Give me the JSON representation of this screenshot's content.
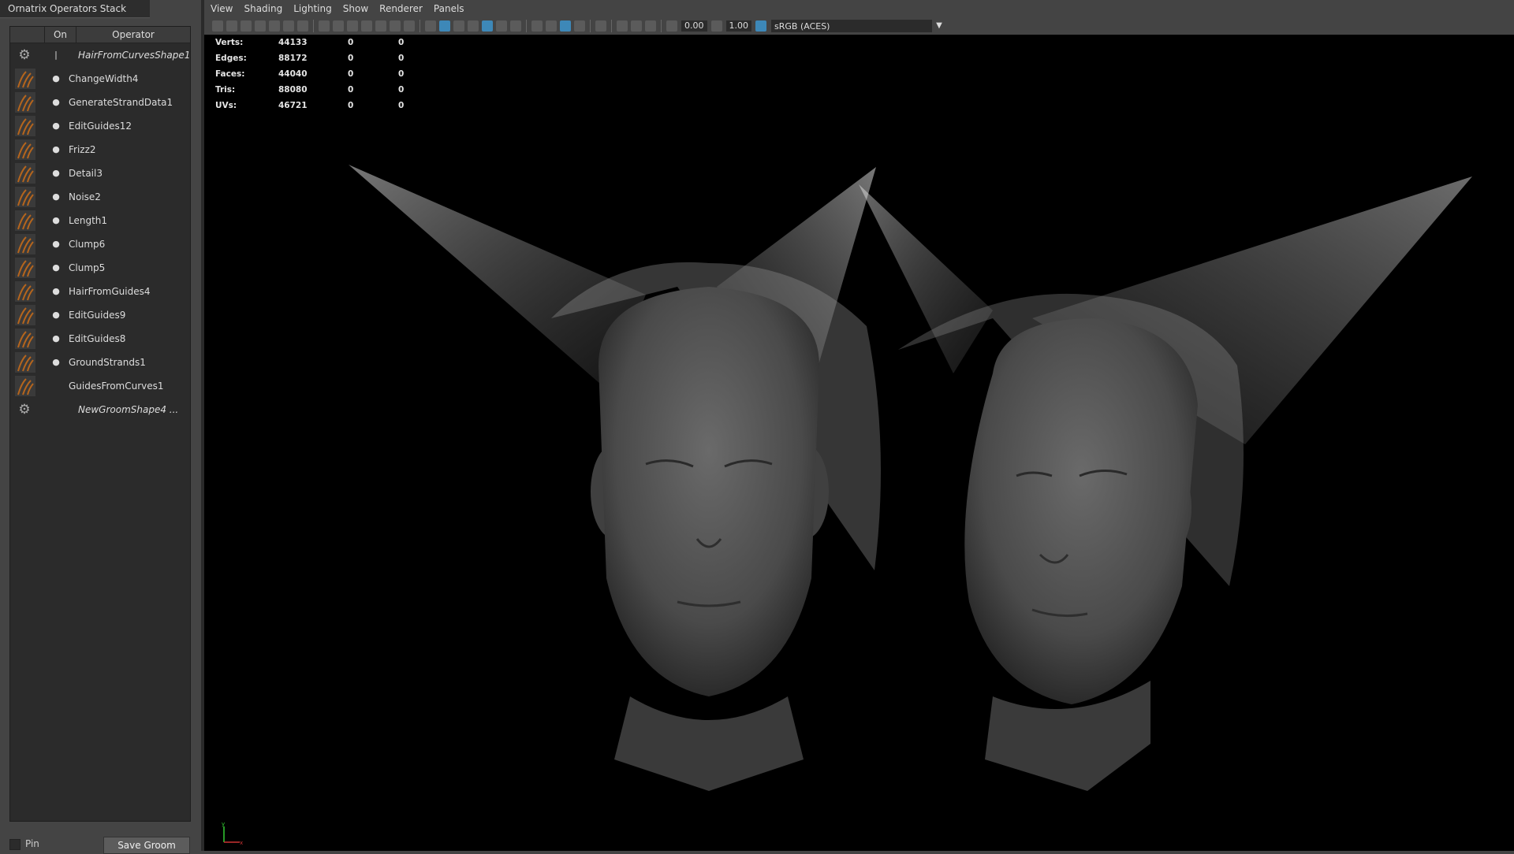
{
  "ops_panel": {
    "title": "Ornatrix Operators Stack",
    "columns": {
      "on": "On",
      "operator": "Operator"
    },
    "rows": [
      {
        "label": "HairFromCurvesShape1",
        "icon": "gear-icon",
        "italic": true,
        "has_toggle": false,
        "is_shape": true
      },
      {
        "label": "ChangeWidth4",
        "icon": "change-width-icon",
        "italic": false,
        "has_toggle": true
      },
      {
        "label": "GenerateStrandData1",
        "icon": "generate-strand-data-icon",
        "italic": false,
        "has_toggle": true
      },
      {
        "label": "EditGuides12",
        "icon": "edit-guides-icon",
        "italic": false,
        "has_toggle": true
      },
      {
        "label": "Frizz2",
        "icon": "frizz-icon",
        "italic": false,
        "has_toggle": true
      },
      {
        "label": "Detail3",
        "icon": "detail-icon",
        "italic": false,
        "has_toggle": true
      },
      {
        "label": "Noise2",
        "icon": "noise-icon",
        "italic": false,
        "has_toggle": true
      },
      {
        "label": "Length1",
        "icon": "length-icon",
        "italic": false,
        "has_toggle": true
      },
      {
        "label": "Clump6",
        "icon": "clump-icon",
        "italic": false,
        "has_toggle": true
      },
      {
        "label": "Clump5",
        "icon": "clump-icon",
        "italic": false,
        "has_toggle": true
      },
      {
        "label": "HairFromGuides4",
        "icon": "hair-from-guides-icon",
        "italic": false,
        "has_toggle": true
      },
      {
        "label": "EditGuides9",
        "icon": "edit-guides-icon",
        "italic": false,
        "has_toggle": true
      },
      {
        "label": "EditGuides8",
        "icon": "edit-guides-icon",
        "italic": false,
        "has_toggle": true
      },
      {
        "label": "GroundStrands1",
        "icon": "ground-strands-icon",
        "italic": false,
        "has_toggle": true
      },
      {
        "label": "GuidesFromCurves1",
        "icon": "guides-from-curves-icon",
        "italic": false,
        "has_toggle": false
      },
      {
        "label": "NewGroomShape4 ...",
        "icon": "gear-icon",
        "italic": true,
        "has_toggle": false,
        "is_shape": true
      }
    ],
    "pin_label": "Pin",
    "save_groom_label": "Save Groom"
  },
  "menubar": {
    "items": [
      "View",
      "Shading",
      "Lighting",
      "Show",
      "Renderer",
      "Panels"
    ]
  },
  "toolbar": {
    "exposure": "0.00",
    "gamma": "1.00",
    "color_space": "sRGB (ACES)"
  },
  "hud": {
    "rows": [
      {
        "label": "Verts:",
        "v1": "44133",
        "v2": "0",
        "v3": "0"
      },
      {
        "label": "Edges:",
        "v1": "88172",
        "v2": "0",
        "v3": "0"
      },
      {
        "label": "Faces:",
        "v1": "44040",
        "v2": "0",
        "v3": "0"
      },
      {
        "label": "Tris:",
        "v1": "88080",
        "v2": "0",
        "v3": "0"
      },
      {
        "label": "UVs:",
        "v1": "46721",
        "v2": "0",
        "v3": "0"
      }
    ]
  },
  "colors": {
    "panel_bg": "#444444",
    "list_bg": "#2b2b2b",
    "viewport_bg": "#000000",
    "accent": "#3d88b8",
    "icon_orange": "#b5651d"
  }
}
